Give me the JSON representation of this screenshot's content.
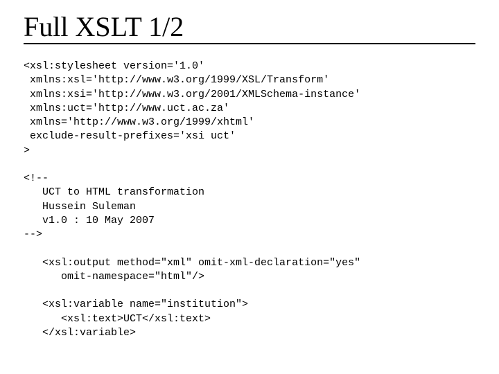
{
  "title": "Full XSLT 1/2",
  "code": "<xsl:stylesheet version='1.0'\n xmlns:xsl='http://www.w3.org/1999/XSL/Transform'\n xmlns:xsi='http://www.w3.org/2001/XMLSchema-instance'\n xmlns:uct='http://www.uct.ac.za'\n xmlns='http://www.w3.org/1999/xhtml'\n exclude-result-prefixes='xsi uct'\n>\n\n<!--\n   UCT to HTML transformation\n   Hussein Suleman\n   v1.0 : 10 May 2007\n-->\n\n   <xsl:output method=\"xml\" omit-xml-declaration=\"yes\"\n      omit-namespace=\"html\"/>\n\n   <xsl:variable name=\"institution\">\n      <xsl:text>UCT</xsl:text>\n   </xsl:variable>"
}
